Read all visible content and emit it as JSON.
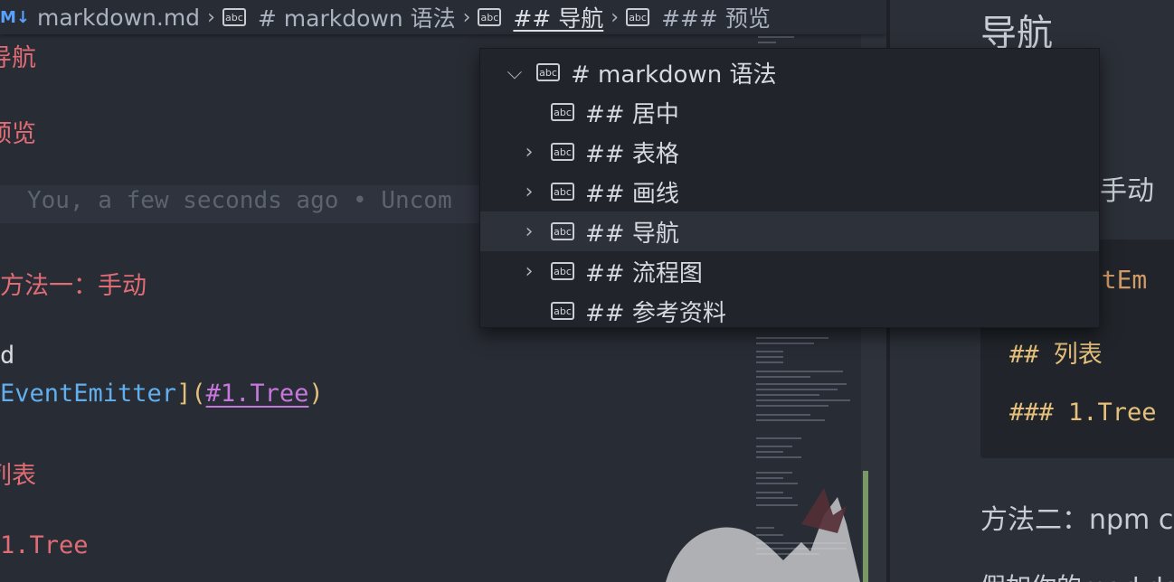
{
  "breadcrumb": {
    "file_icon": "M↓",
    "file": "markdown.md",
    "separator": "›",
    "abc": "abc",
    "h1": "# markdown 语法",
    "h2": "## 导航",
    "h3": "### 预览"
  },
  "editor": {
    "lines": {
      "nav": "导航",
      "preview": "预览",
      "blame": "You, a few seconds ago • Uncom",
      "method1": "方法一：手动",
      "d": "d",
      "link_text": "EventEmitter",
      "link_open": "](",
      "link_target": "#1.Tree",
      "link_close": ")",
      "list": "列表",
      "tree": "1.Tree"
    }
  },
  "outline_dropdown": {
    "abc": "abc",
    "items": [
      {
        "label": "# markdown 语法",
        "chevron": "expanded"
      },
      {
        "label": "## 居中",
        "chevron": "none"
      },
      {
        "label": "## 表格",
        "chevron": "collapsed"
      },
      {
        "label": "## 画线",
        "chevron": "collapsed"
      },
      {
        "label": "## 导航",
        "chevron": "collapsed",
        "selected": true
      },
      {
        "label": "## 流程图",
        "chevron": "collapsed"
      },
      {
        "label": "## 参考资料",
        "chevron": "none"
      }
    ],
    "chevron_expanded": "⌵",
    "chevron_collapsed": "›"
  },
  "preview": {
    "heading": "导航",
    "method1": "手动",
    "code_line1": "entEm",
    "code_line2": "## 列表",
    "code_line3": "### 1.Tree",
    "method2": "方法二：npm c",
    "partial": "假如你的markdo"
  },
  "colors": {
    "editor_bg": "#282c34",
    "heading_red": "#e06c75",
    "link_blue": "#61afef",
    "code_yellow": "#e5c07b",
    "link_purple": "#c678dd",
    "dropdown_bg": "#21252b",
    "selected_bg": "#2c313a"
  }
}
